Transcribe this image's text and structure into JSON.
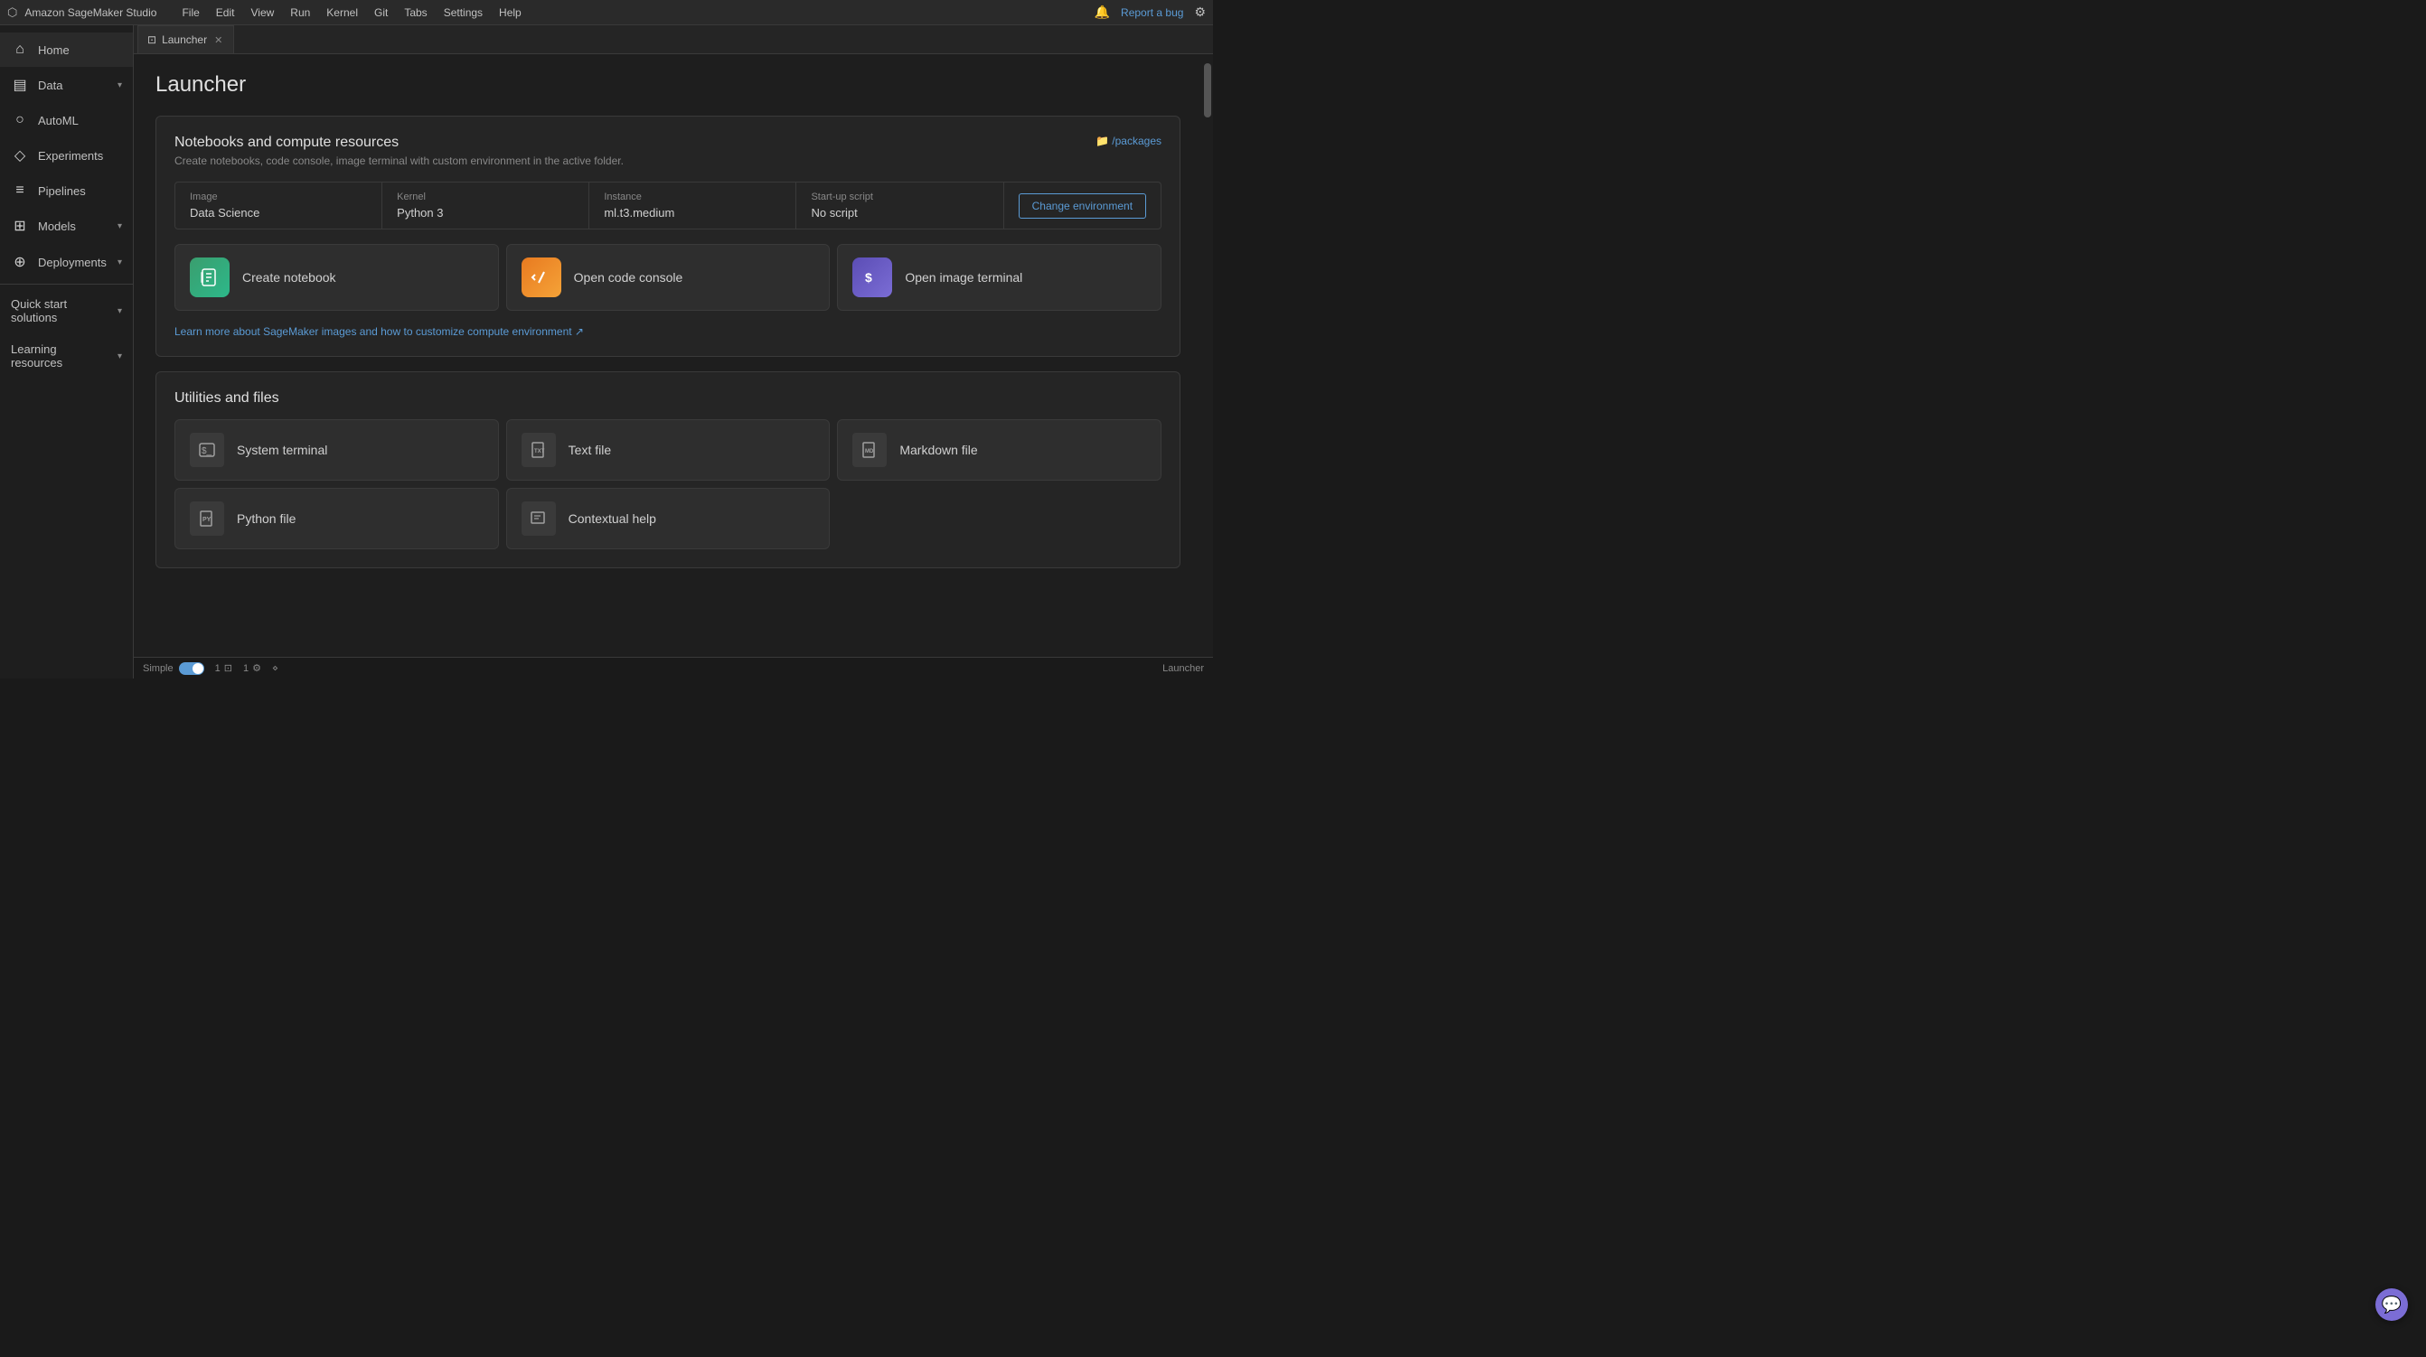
{
  "app": {
    "title": "Amazon SageMaker Studio",
    "logo": "⬡"
  },
  "menubar": {
    "items": [
      "File",
      "Edit",
      "View",
      "Run",
      "Kernel",
      "Git",
      "Tabs",
      "Settings",
      "Help"
    ],
    "report_bug": "Report a bug"
  },
  "sidebar": {
    "items": [
      {
        "id": "home",
        "label": "Home",
        "icon": "⌂",
        "hasChevron": false,
        "active": true
      },
      {
        "id": "data",
        "label": "Data",
        "icon": "▤",
        "hasChevron": true
      },
      {
        "id": "automl",
        "label": "AutoML",
        "icon": "○",
        "hasChevron": false
      },
      {
        "id": "experiments",
        "label": "Experiments",
        "icon": "◇",
        "hasChevron": false
      },
      {
        "id": "pipelines",
        "label": "Pipelines",
        "icon": "≡",
        "hasChevron": false
      },
      {
        "id": "models",
        "label": "Models",
        "icon": "⊞",
        "hasChevron": true
      },
      {
        "id": "deployments",
        "label": "Deployments",
        "icon": "⊕",
        "hasChevron": true
      },
      {
        "id": "quickstart",
        "label": "Quick start solutions",
        "icon": "",
        "hasChevron": true
      },
      {
        "id": "learning",
        "label": "Learning resources",
        "icon": "",
        "hasChevron": true
      }
    ]
  },
  "tab": {
    "icon": "⊡",
    "label": "Launcher",
    "close": "✕"
  },
  "launcher": {
    "title": "Launcher",
    "notebooks_section": {
      "title": "Notebooks and compute resources",
      "subtitle": "Create notebooks, code console, image terminal with custom environment in the active folder.",
      "packages_link": "📁 /packages",
      "environment": {
        "image_label": "Image",
        "image_value": "Data Science",
        "kernel_label": "Kernel",
        "kernel_value": "Python 3",
        "instance_label": "Instance",
        "instance_value": "ml.t3.medium",
        "startup_label": "Start-up script",
        "startup_value": "No script",
        "change_btn": "Change environment"
      },
      "actions": [
        {
          "id": "create-notebook",
          "label": "Create notebook",
          "icon": "⊞",
          "color_class": "icon-green"
        },
        {
          "id": "open-code-console",
          "label": "Open code console",
          "icon": "▶",
          "color_class": "icon-orange"
        },
        {
          "id": "open-image-terminal",
          "label": "Open image terminal",
          "icon": "$",
          "color_class": "icon-purple"
        }
      ],
      "learn_more": "Learn more about SageMaker images and how to customize compute environment ↗"
    },
    "utilities_section": {
      "title": "Utilities and files",
      "items": [
        {
          "id": "system-terminal",
          "label": "System terminal",
          "icon": "⊡"
        },
        {
          "id": "text-file",
          "label": "Text file",
          "icon": "TXT"
        },
        {
          "id": "markdown-file",
          "label": "Markdown file",
          "icon": "MD"
        },
        {
          "id": "python-file",
          "label": "Python file",
          "icon": "PY"
        },
        {
          "id": "contextual-help",
          "label": "Contextual help",
          "icon": "⊡"
        }
      ]
    }
  },
  "statusbar": {
    "mode_label": "Simple",
    "count1": "1",
    "count2": "1",
    "right_label": "Launcher"
  }
}
